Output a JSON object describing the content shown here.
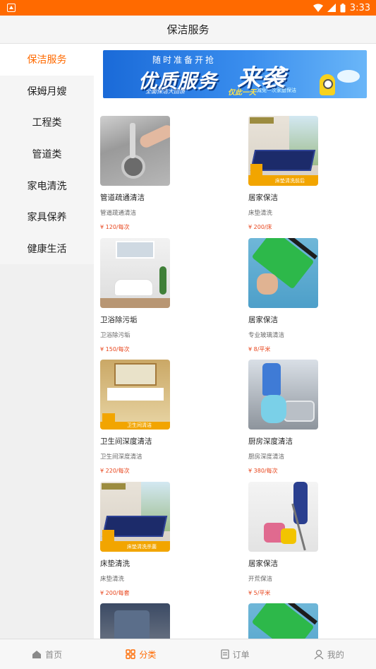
{
  "status_bar": {
    "time": "3:33"
  },
  "header": {
    "title": "保洁服务"
  },
  "sidebar": {
    "items": [
      {
        "label": "保洁服务",
        "active": true
      },
      {
        "label": "保姆月嫂",
        "active": false
      },
      {
        "label": "工程类",
        "active": false
      },
      {
        "label": "管道类",
        "active": false
      },
      {
        "label": "家电清洗",
        "active": false
      },
      {
        "label": "家具保养",
        "active": false
      },
      {
        "label": "健康生活",
        "active": false
      }
    ]
  },
  "banner": {
    "line1": "随时准备开抢",
    "headline_a": "优质服务",
    "headline_b": "来袭",
    "sub1": "全面保洁大回馈",
    "sub2": "仅此一天",
    "sub3": "减免一次家庭保洁"
  },
  "products": [
    {
      "title": "管道疏通清洁",
      "subtitle": "管道疏通清洁",
      "price": "¥ 120/每次"
    },
    {
      "title": "居家保洁",
      "subtitle": "床垫清洗",
      "price": "¥ 200/床"
    },
    {
      "title": "卫浴除污垢",
      "subtitle": "卫浴除污垢",
      "price": "¥ 150/每次"
    },
    {
      "title": "居家保洁",
      "subtitle": "专业玻璃清洁",
      "price": "¥ 8/平米"
    },
    {
      "title": "卫生间深度清洁",
      "subtitle": "卫生间深度清洁",
      "price": "¥ 220/每次"
    },
    {
      "title": "厨房深度清洁",
      "subtitle": "厨房深度清洁",
      "price": "¥ 380/每次"
    },
    {
      "title": "床垫清洗",
      "subtitle": "床垫清洗",
      "price": "¥ 200/每套"
    },
    {
      "title": "居家保洁",
      "subtitle": "开荒保洁",
      "price": "¥ 5/平米"
    }
  ],
  "thumb_labels": {
    "bed": "床垫清洗前后",
    "toilet": "卫生间清洁",
    "bed2": "床垫清洗杀菌"
  },
  "tabbar": {
    "items": [
      {
        "label": "首页",
        "icon": "home-icon",
        "active": false
      },
      {
        "label": "分类",
        "icon": "category-icon",
        "active": true
      },
      {
        "label": "订单",
        "icon": "order-icon",
        "active": false
      },
      {
        "label": "我的",
        "icon": "profile-icon",
        "active": false
      }
    ]
  },
  "colors": {
    "accent": "#ff6a00",
    "price": "#e8451c"
  }
}
